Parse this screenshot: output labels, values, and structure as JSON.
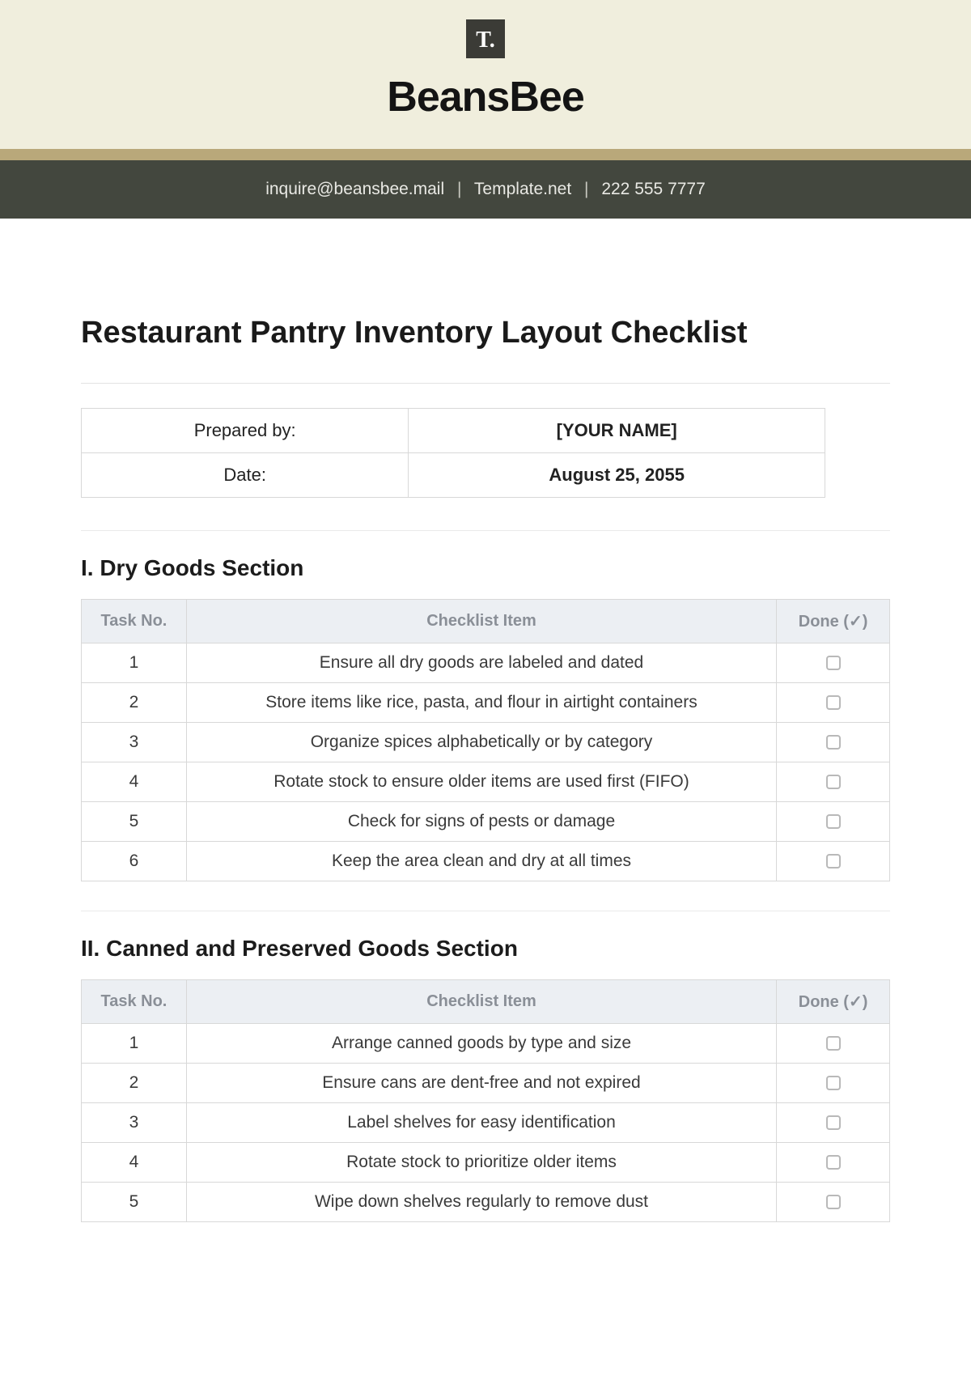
{
  "header": {
    "logo_text": "T.",
    "brand": "BeansBee",
    "email": "inquire@beansbee.mail",
    "site": "Template.net",
    "phone": "222 555 7777"
  },
  "document": {
    "title": "Restaurant Pantry Inventory Layout Checklist",
    "meta": {
      "prepared_label": "Prepared by:",
      "prepared_value": "[YOUR NAME]",
      "date_label": "Date:",
      "date_value": "August 25, 2055"
    }
  },
  "columns": {
    "task_no": "Task No.",
    "item": "Checklist Item",
    "done": "Done (✓)"
  },
  "sections": [
    {
      "title": "I. Dry Goods Section",
      "rows": [
        {
          "no": "1",
          "item": "Ensure all dry goods are labeled and dated"
        },
        {
          "no": "2",
          "item": "Store items like rice, pasta, and flour in airtight containers"
        },
        {
          "no": "3",
          "item": "Organize spices alphabetically or by category"
        },
        {
          "no": "4",
          "item": "Rotate stock to ensure older items are used first (FIFO)"
        },
        {
          "no": "5",
          "item": "Check for signs of pests or damage"
        },
        {
          "no": "6",
          "item": "Keep the area clean and dry at all times"
        }
      ]
    },
    {
      "title": "II. Canned and Preserved Goods Section",
      "rows": [
        {
          "no": "1",
          "item": "Arrange canned goods by type and size"
        },
        {
          "no": "2",
          "item": "Ensure cans are dent-free and not expired"
        },
        {
          "no": "3",
          "item": "Label shelves for easy identification"
        },
        {
          "no": "4",
          "item": "Rotate stock to prioritize older items"
        },
        {
          "no": "5",
          "item": "Wipe down shelves regularly to remove dust"
        }
      ]
    }
  ]
}
